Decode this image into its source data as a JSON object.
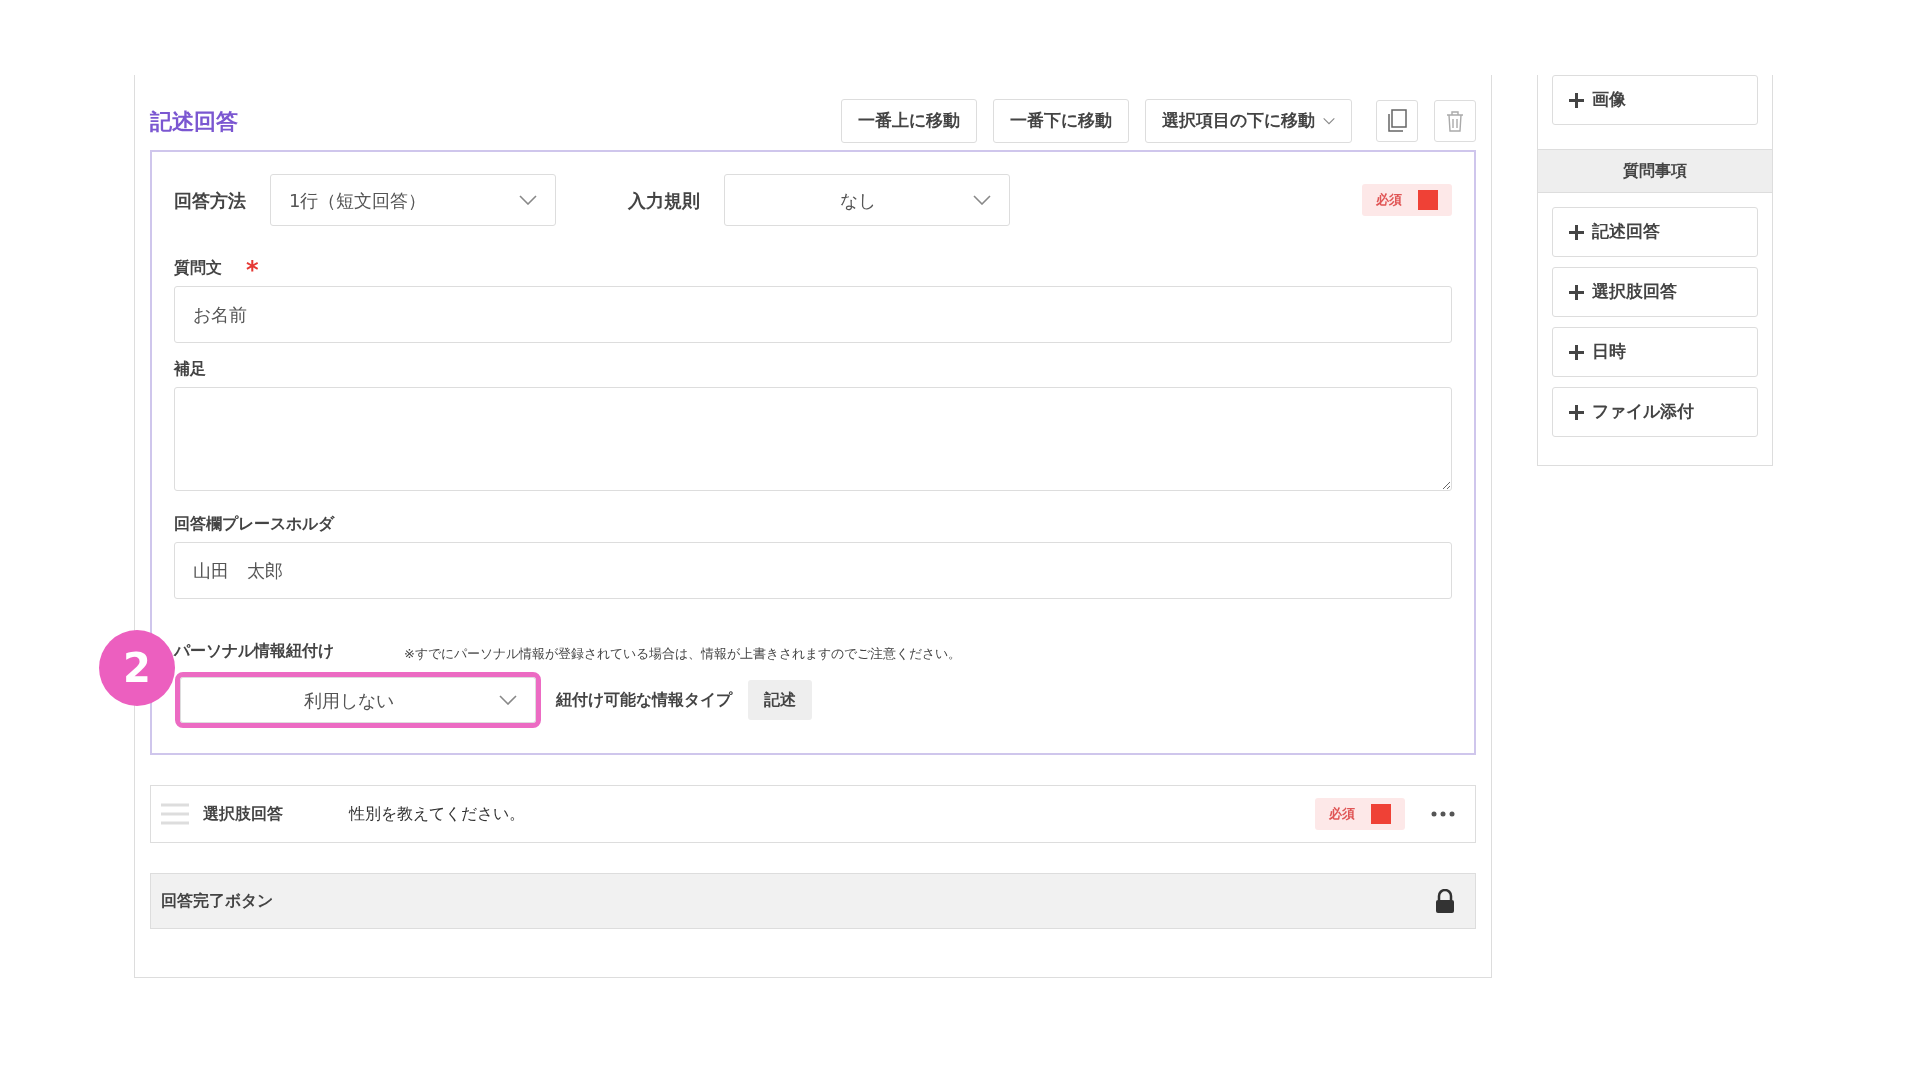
{
  "editor": {
    "title": "記述回答",
    "toolbar": [
      {
        "kind": "button",
        "label": "一番上に移動"
      },
      {
        "kind": "button",
        "label": "一番下に移動"
      },
      {
        "kind": "dropdown",
        "label": "選択項目の下に移動"
      },
      {
        "kind": "copy"
      },
      {
        "kind": "delete"
      }
    ],
    "answer_method": {
      "label": "回答方法",
      "value": "1行（短文回答）"
    },
    "input_rule": {
      "label": "入力規則",
      "value": "なし"
    },
    "required": {
      "label": "必須",
      "on": true
    },
    "question": {
      "label": "質問文",
      "mark": "*",
      "value": "お名前"
    },
    "note": {
      "label": "補足"
    },
    "placeholder_field": {
      "label": "回答欄プレースホルダ",
      "value": "山田　太郎"
    },
    "personal": {
      "label": "パーソナル情報紐付け",
      "notice": "※すでにパーソナル情報が登録されている場合は、情報が上書きされますのでご注意ください。",
      "value": "利用しない",
      "highlighted": true,
      "type_label": "紐付け可能な情報タイプ",
      "type_value": "記述"
    },
    "callout": "2"
  },
  "questions": [
    {
      "type": "選択肢回答",
      "text": "性別を教えてください。",
      "required_label": "必須",
      "required": true
    }
  ],
  "completion": {
    "label": "回答完了ボタン",
    "locked": true
  },
  "sidebar": {
    "top_items": [
      "画像"
    ],
    "header": "質問事項",
    "items": [
      "記述回答",
      "選択肢回答",
      "日時",
      "ファイル添付"
    ]
  }
}
